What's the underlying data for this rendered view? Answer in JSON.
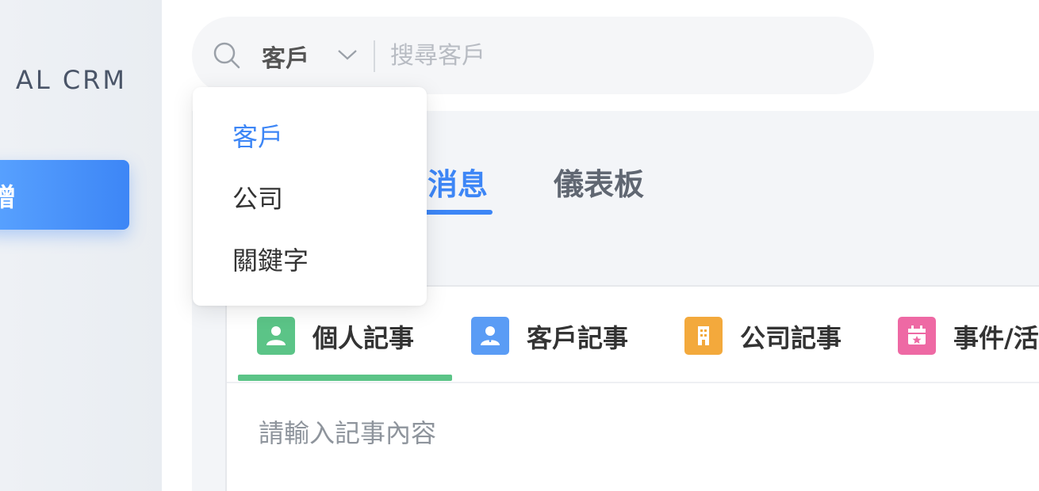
{
  "sidebar": {
    "brand": "AL CRM",
    "new_button_label": "增"
  },
  "search": {
    "type_label": "客戶",
    "placeholder": "搜尋客戶",
    "value": ""
  },
  "dropdown": {
    "items": [
      {
        "label": "客戶",
        "selected": true
      },
      {
        "label": "公司",
        "selected": false
      },
      {
        "label": "關鍵字",
        "selected": false
      }
    ]
  },
  "main_tabs": [
    {
      "label": "消息",
      "active": true
    },
    {
      "label": "儀表板",
      "active": false
    }
  ],
  "note_tabs": [
    {
      "label": "個人記事",
      "icon": "person-icon",
      "color": "#5bc487",
      "active": true
    },
    {
      "label": "客戶記事",
      "icon": "client-icon",
      "color": "#5a9cf5",
      "active": false
    },
    {
      "label": "公司記事",
      "icon": "building-icon",
      "color": "#f3a93c",
      "active": false
    },
    {
      "label": "事件/活",
      "icon": "calendar-icon",
      "color": "#ee69a4",
      "active": false
    }
  ],
  "note_editor": {
    "placeholder": "請輸入記事內容"
  },
  "colors": {
    "accent": "#3d86f6",
    "active_note_tab": "#5bc487"
  }
}
